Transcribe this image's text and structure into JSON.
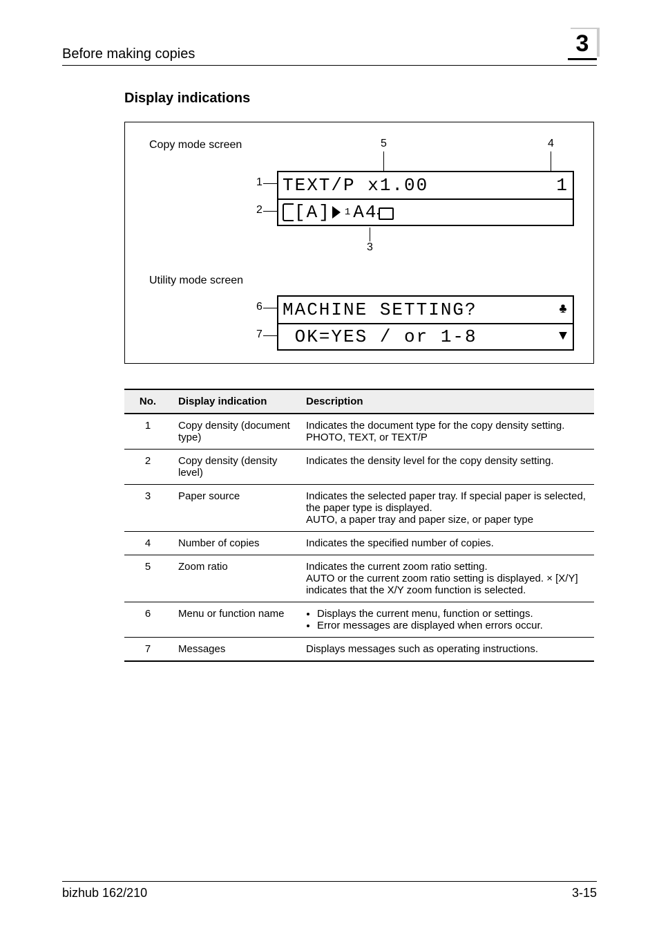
{
  "header": {
    "breadcrumb": "Before making copies",
    "chapter_number": "3"
  },
  "section": {
    "heading": "Display indications"
  },
  "figure": {
    "labels": {
      "copy_mode": "Copy mode screen",
      "utility_mode": "Utility mode screen"
    },
    "callouts": {
      "c1": "1",
      "c2": "2",
      "c3": "3",
      "c4": "4",
      "c5": "5",
      "c6": "6",
      "c7": "7"
    },
    "lcd": {
      "row1_left": "TEXT/P x1.00",
      "row1_right": "1",
      "row2_density": "[A]",
      "row2_source_super": "1",
      "row2_source": "A4",
      "row6_left": "MACHINE SETTING?",
      "row7_left": " OK=YES / or 1-8"
    }
  },
  "table": {
    "headers": {
      "no": "No.",
      "indication": "Display indication",
      "description": "Description"
    },
    "rows": [
      {
        "no": "1",
        "indication": "Copy density (document type)",
        "description": "Indicates the document type for the copy density setting.\nPHOTO, TEXT, or TEXT/P"
      },
      {
        "no": "2",
        "indication": "Copy density (density level)",
        "description": "Indicates the density level for the copy density setting."
      },
      {
        "no": "3",
        "indication": "Paper source",
        "description": "Indicates the selected paper tray. If special paper is selected, the paper type is displayed.\nAUTO, a paper tray and paper size, or paper type"
      },
      {
        "no": "4",
        "indication": "Number of copies",
        "description": "Indicates the specified number of copies."
      },
      {
        "no": "5",
        "indication": "Zoom ratio",
        "description": "Indicates the current zoom ratio setting.\nAUTO or the current zoom ratio setting is displayed. × [X/Y] indicates that the X/Y zoom function is selected."
      },
      {
        "no": "6",
        "indication": "Menu or function name",
        "description_list": [
          "Displays the current menu, function or settings.",
          "Error messages are displayed when errors occur."
        ]
      },
      {
        "no": "7",
        "indication": "Messages",
        "description": "Displays messages such as operating instructions."
      }
    ]
  },
  "footer": {
    "model": "bizhub 162/210",
    "page": "3-15"
  }
}
